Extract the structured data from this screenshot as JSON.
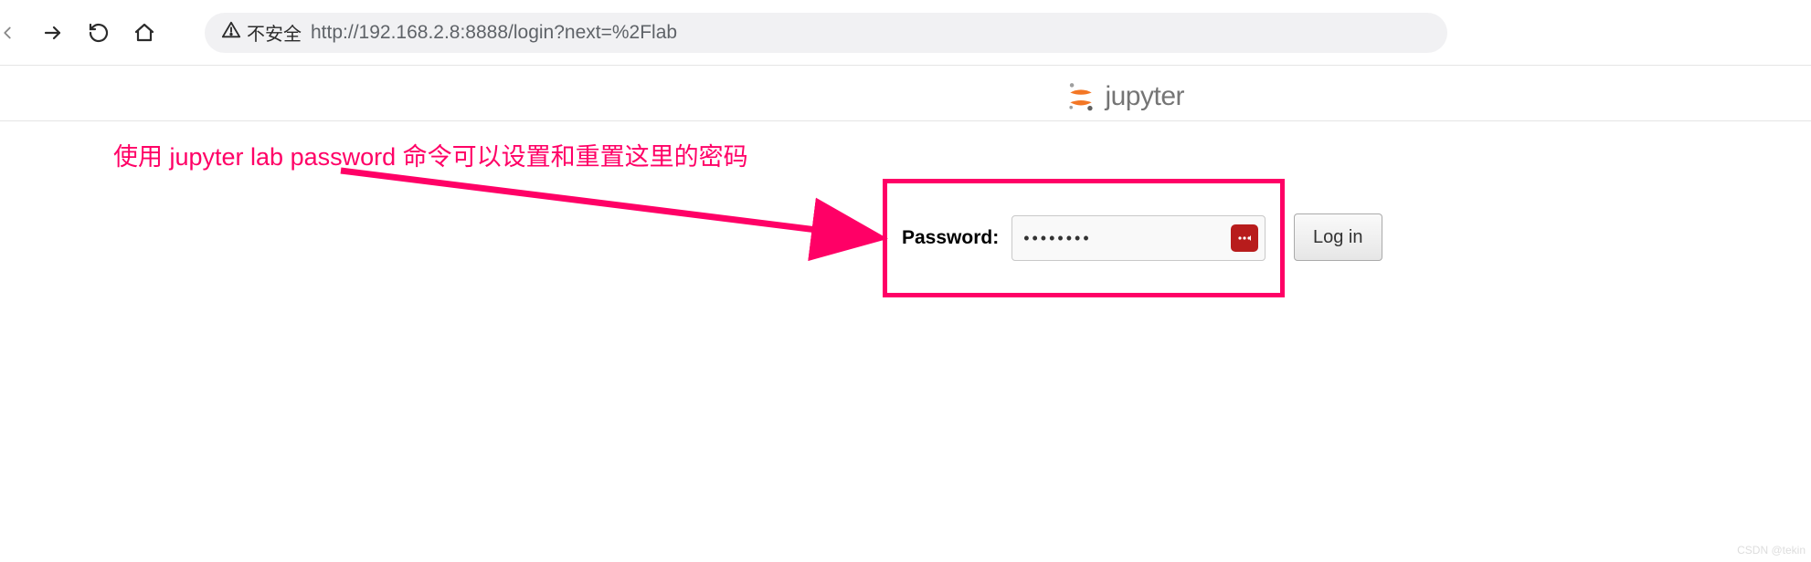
{
  "browser": {
    "security_label": "不安全",
    "url": "http://192.168.2.8:8888/login?next=%2Flab"
  },
  "logo": {
    "text": "jupyter"
  },
  "annotation": {
    "text": "使用 jupyter lab password  命令可以设置和重置这里的密码"
  },
  "login": {
    "password_label": "Password:",
    "password_value": "••••••••",
    "button_label": "Log in"
  },
  "watermark": "CSDN @tekin"
}
